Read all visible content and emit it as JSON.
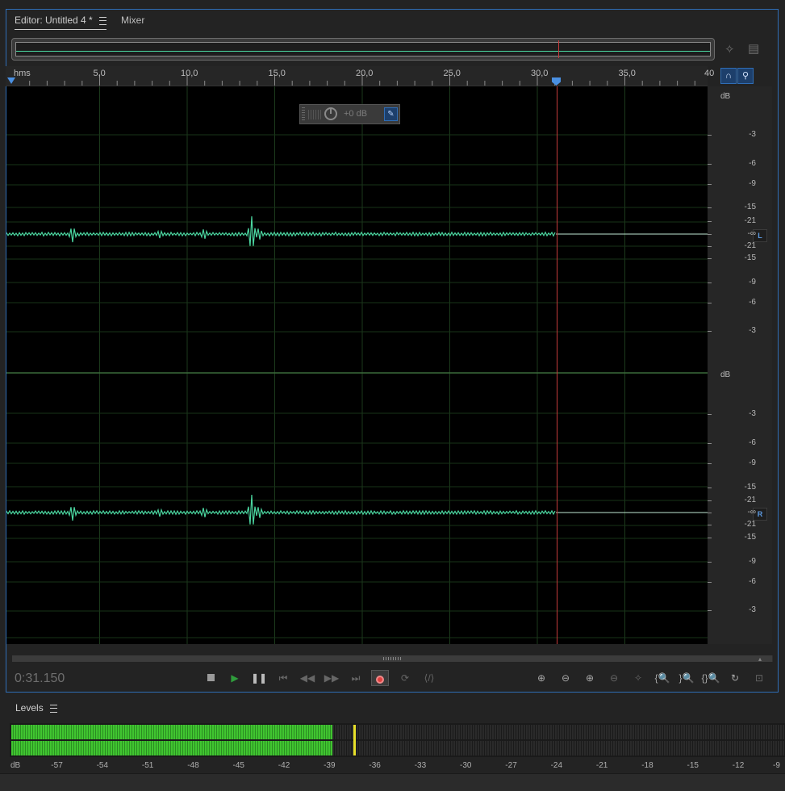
{
  "tabs": {
    "editor": "Editor: Untitled 4 *",
    "mixer": "Mixer"
  },
  "ruler": {
    "unit": "hms",
    "labels": [
      "5,0",
      "10,0",
      "15,0",
      "20,0",
      "25,0",
      "30,0",
      "35,0",
      "40"
    ]
  },
  "hud": {
    "volume": "+0 dB"
  },
  "db_scale": {
    "top_channel": [
      "dB",
      "-3",
      "-6",
      "-9",
      "-15",
      "-21",
      "-∞",
      "-21",
      "-15",
      "-9",
      "-6",
      "-3"
    ],
    "bottom_channel": [
      "dB",
      "-3",
      "-6",
      "-9",
      "-15",
      "-21",
      "-∞",
      "-21",
      "-15",
      "-9",
      "-6",
      "-3"
    ],
    "left_label": "L",
    "right_label": "R"
  },
  "transport": {
    "time": "0:31.150"
  },
  "levels": {
    "title": "Levels",
    "scale": [
      "dB",
      "-57",
      "-54",
      "-51",
      "-48",
      "-45",
      "-42",
      "-39",
      "-36",
      "-33",
      "-30",
      "-27",
      "-24",
      "-21",
      "-18",
      "-15",
      "-12",
      "-9"
    ]
  },
  "colors": {
    "waveform": "#4bd6a0",
    "playhead": "#c43b3b",
    "accent": "#2f6db5",
    "meter_green": "#40c530",
    "peak_hold": "#e8e02a"
  },
  "playhead_seconds": 31.15
}
